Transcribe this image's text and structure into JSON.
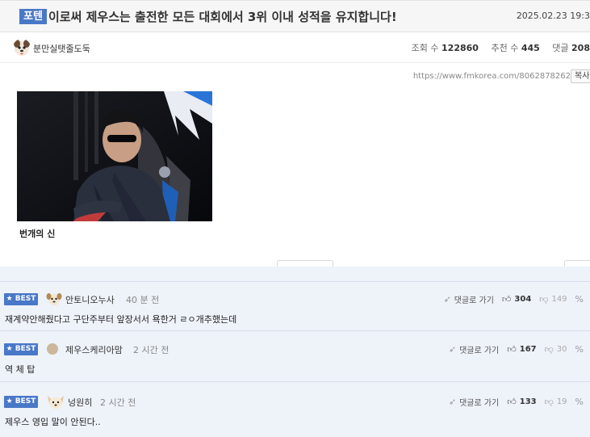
{
  "post": {
    "category": "포텐",
    "title": "이로써 제우스는 출전한 모든 대회에서 3위 이내 성적을 유지합니다!",
    "date": "2025.02.23 19:3",
    "author": "분만실탯줄도둑",
    "views_label": "조회 수",
    "views": "122860",
    "likes_label": "추천 수",
    "likes": "445",
    "comments_label": "댓글",
    "comments": "208",
    "url": "https://www.fmkorea.com/8062878262",
    "copy_label": "복사",
    "image_caption": "번개의 신"
  },
  "comments": [
    {
      "badge": "★ BEST",
      "avatar": "dog-face-icon",
      "name": "안토니오누사",
      "time": "40 분 전",
      "text": "재계약안해줬다고 구단주부터 앞장서서 욕한거 ㄹㅇ개추했는데",
      "reply_label": "댓글로 가기",
      "up": "304",
      "down": "149"
    },
    {
      "badge": "★ BEST",
      "avatar": "default-circle-avatar",
      "name": "제우스케리아맘",
      "time": "2 시간 전",
      "text": "역 체 탑",
      "reply_label": "댓글로 가기",
      "up": "167",
      "down": "30"
    },
    {
      "badge": "★ BEST",
      "avatar": "dog-face-icon",
      "name": "넝원히",
      "time": "2 시간 전",
      "text": "제우스 영입 말이 안된다..",
      "reply_label": "댓글로 가기",
      "up": "133",
      "down": "19"
    }
  ],
  "icons": {
    "reply": "send-arrow-icon",
    "up": "thumbs-up-icon",
    "down": "thumbs-down-icon",
    "link": "link-icon"
  },
  "colors": {
    "accent": "#4a78c8",
    "comment_bg": "#eef2f9"
  }
}
